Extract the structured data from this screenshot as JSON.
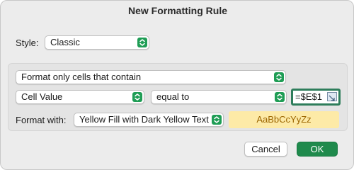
{
  "dialog": {
    "title": "New Formatting Rule"
  },
  "style": {
    "label": "Style:",
    "value": "Classic"
  },
  "rule": {
    "type": "Format only cells that contain",
    "condition_subject": "Cell Value",
    "operator": "equal to",
    "formula": "=$E$1"
  },
  "format": {
    "label": "Format with:",
    "value": "Yellow Fill with Dark Yellow Text",
    "preview_text": "AaBbCcYyZz",
    "preview_fill": "#fdeaa7",
    "preview_text_color": "#9c6500"
  },
  "buttons": {
    "cancel": "Cancel",
    "ok": "OK"
  },
  "colors": {
    "accent": "#1f8a4c",
    "stepper": "#1f9d55"
  },
  "icons": {
    "stepper": "up-down-chevron-icon",
    "range_picker": "range-picker-icon"
  }
}
